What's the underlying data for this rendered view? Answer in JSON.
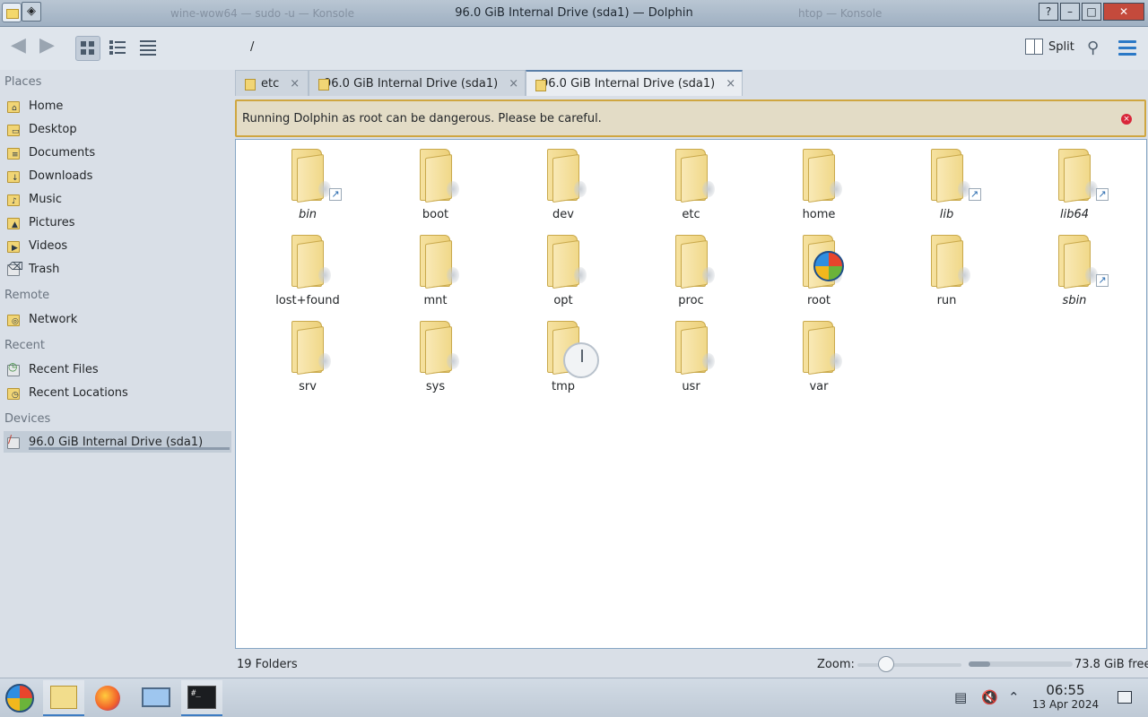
{
  "titlebar": {
    "title": "96.0 GiB Internal Drive (sda1) — Dolphin",
    "ghost_left": "wine-wow64 — sudo -u — Konsole",
    "ghost_right": "htop — Konsole",
    "help_label": "?",
    "minimize_label": "–",
    "maximize_label": "□",
    "close_label": "✕"
  },
  "toolbar": {
    "path": "/",
    "split_label": "Split"
  },
  "sidebar": {
    "places_header": "Places",
    "places": [
      {
        "label": "Home",
        "icon": "home-icon"
      },
      {
        "label": "Desktop",
        "icon": "desktop-icon"
      },
      {
        "label": "Documents",
        "icon": "documents-icon"
      },
      {
        "label": "Downloads",
        "icon": "downloads-icon"
      },
      {
        "label": "Music",
        "icon": "music-icon"
      },
      {
        "label": "Pictures",
        "icon": "pictures-icon"
      },
      {
        "label": "Videos",
        "icon": "videos-icon"
      },
      {
        "label": "Trash",
        "icon": "trash-icon"
      }
    ],
    "remote_header": "Remote",
    "remote": [
      {
        "label": "Network",
        "icon": "network-icon"
      }
    ],
    "recent_header": "Recent",
    "recent": [
      {
        "label": "Recent Files",
        "icon": "recent-files-icon"
      },
      {
        "label": "Recent Locations",
        "icon": "recent-locations-icon"
      }
    ],
    "devices_header": "Devices",
    "devices": [
      {
        "label": "96.0 GiB Internal Drive (sda1)",
        "icon": "drive-icon"
      }
    ]
  },
  "tabs": [
    {
      "label": "etc",
      "close": "×"
    },
    {
      "label": "96.0 GiB Internal Drive (sda1)",
      "close": "×"
    },
    {
      "label": "96.0 GiB Internal Drive (sda1)",
      "close": "×",
      "active": true
    }
  ],
  "banner": {
    "text": "Running Dolphin as root can be dangerous. Please be careful.",
    "close": "×"
  },
  "folders": [
    {
      "name": "bin",
      "symlink": true
    },
    {
      "name": "boot"
    },
    {
      "name": "dev"
    },
    {
      "name": "etc"
    },
    {
      "name": "home"
    },
    {
      "name": "lib",
      "symlink": true
    },
    {
      "name": "lib64",
      "symlink": true
    },
    {
      "name": "lost+found"
    },
    {
      "name": "mnt"
    },
    {
      "name": "opt"
    },
    {
      "name": "proc"
    },
    {
      "name": "root",
      "badge": "windows-logo-icon"
    },
    {
      "name": "run"
    },
    {
      "name": "sbin",
      "symlink": true
    },
    {
      "name": "srv"
    },
    {
      "name": "sys"
    },
    {
      "name": "tmp",
      "badge": "clock-icon"
    },
    {
      "name": "usr"
    },
    {
      "name": "var"
    }
  ],
  "statusbar": {
    "count": "19 Folders",
    "zoom_label": "Zoom:",
    "zoom_level": 0.28,
    "free": "73.8 GiB free",
    "used_fraction": 0.21
  },
  "taskbar": {
    "time": "06:55",
    "date": "13 Apr 2024",
    "terminal_glyph": "#_"
  }
}
